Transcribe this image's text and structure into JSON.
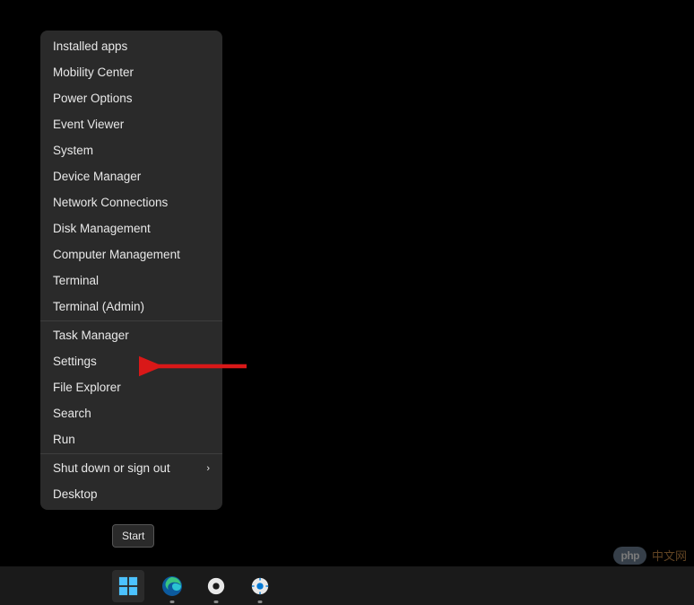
{
  "menu": {
    "sections": [
      [
        {
          "label": "Installed apps"
        },
        {
          "label": "Mobility Center"
        },
        {
          "label": "Power Options"
        },
        {
          "label": "Event Viewer"
        },
        {
          "label": "System"
        },
        {
          "label": "Device Manager"
        },
        {
          "label": "Network Connections"
        },
        {
          "label": "Disk Management"
        },
        {
          "label": "Computer Management"
        },
        {
          "label": "Terminal"
        },
        {
          "label": "Terminal (Admin)"
        }
      ],
      [
        {
          "label": "Task Manager"
        },
        {
          "label": "Settings"
        },
        {
          "label": "File Explorer"
        },
        {
          "label": "Search"
        },
        {
          "label": "Run"
        }
      ],
      [
        {
          "label": "Shut down or sign out",
          "submenu": true
        },
        {
          "label": "Desktop"
        }
      ]
    ]
  },
  "tooltip": {
    "text": "Start"
  },
  "watermark": {
    "badge": "php",
    "text": "中文网"
  },
  "taskbar": {
    "icons": [
      {
        "name": "start",
        "active": true
      },
      {
        "name": "edge",
        "running": true
      },
      {
        "name": "app1",
        "running": true
      },
      {
        "name": "settings",
        "running": true
      }
    ]
  }
}
